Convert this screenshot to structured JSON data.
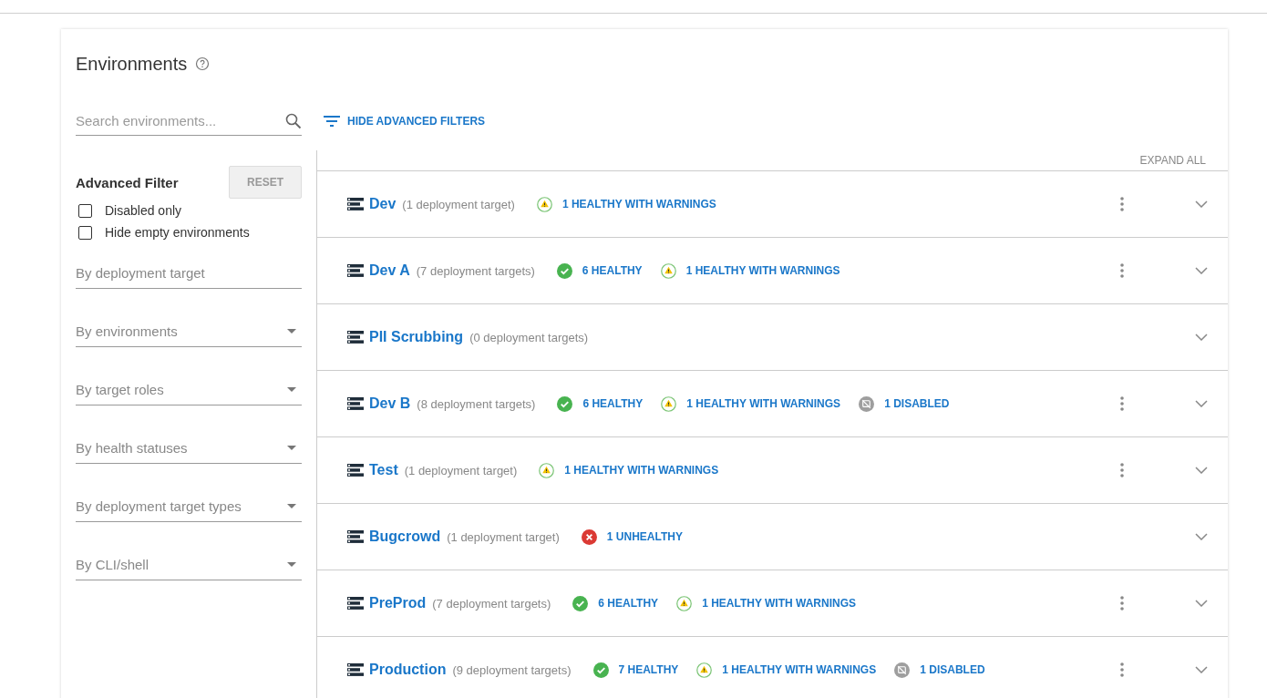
{
  "title": "Environments",
  "search": {
    "placeholder": "Search environments..."
  },
  "filter_toggle": "HIDE ADVANCED FILTERS",
  "expand_all": "EXPAND ALL",
  "advanced_filter": {
    "title": "Advanced Filter",
    "reset": "RESET",
    "checkboxes": [
      {
        "label": "Disabled only",
        "checked": false
      },
      {
        "label": "Hide empty environments",
        "checked": false
      }
    ],
    "fields": [
      {
        "kind": "text",
        "placeholder": "By deployment target"
      },
      {
        "kind": "select",
        "placeholder": "By environments"
      },
      {
        "kind": "select",
        "placeholder": "By target roles"
      },
      {
        "kind": "select",
        "placeholder": "By health statuses"
      },
      {
        "kind": "select",
        "placeholder": "By deployment target types"
      },
      {
        "kind": "select",
        "placeholder": "By CLI/shell"
      }
    ]
  },
  "environments": [
    {
      "name": "Dev",
      "count": "(1 deployment target)",
      "has_menu": true,
      "statuses": [
        {
          "kind": "warning",
          "label": "1 HEALTHY WITH WARNINGS"
        }
      ]
    },
    {
      "name": "Dev A",
      "count": "(7 deployment targets)",
      "has_menu": true,
      "statuses": [
        {
          "kind": "healthy",
          "label": "6 HEALTHY"
        },
        {
          "kind": "warning",
          "label": "1 HEALTHY WITH WARNINGS"
        }
      ]
    },
    {
      "name": "PII Scrubbing",
      "count": "(0 deployment targets)",
      "has_menu": false
    },
    {
      "name": "Dev B",
      "count": "(8 deployment targets)",
      "has_menu": true,
      "statuses": [
        {
          "kind": "healthy",
          "label": "6 HEALTHY"
        },
        {
          "kind": "warning",
          "label": "1 HEALTHY WITH WARNINGS"
        },
        {
          "kind": "disabled",
          "label": "1 DISABLED"
        }
      ]
    },
    {
      "name": "Test",
      "count": "(1 deployment target)",
      "has_menu": true,
      "statuses": [
        {
          "kind": "warning",
          "label": "1 HEALTHY WITH WARNINGS"
        }
      ]
    },
    {
      "name": "Bugcrowd",
      "count": "(1 deployment target)",
      "has_menu": false,
      "statuses": [
        {
          "kind": "unhealthy",
          "label": "1 UNHEALTHY"
        }
      ]
    },
    {
      "name": "PreProd",
      "count": "(7 deployment targets)",
      "has_menu": true,
      "statuses": [
        {
          "kind": "healthy",
          "label": "6 HEALTHY"
        },
        {
          "kind": "warning",
          "label": "1 HEALTHY WITH WARNINGS"
        }
      ]
    },
    {
      "name": "Production",
      "count": "(9 deployment targets)",
      "has_menu": true,
      "statuses": [
        {
          "kind": "healthy",
          "label": "7 HEALTHY"
        },
        {
          "kind": "warning",
          "label": "1 HEALTHY WITH WARNINGS"
        },
        {
          "kind": "disabled",
          "label": "1 DISABLED"
        }
      ]
    }
  ]
}
